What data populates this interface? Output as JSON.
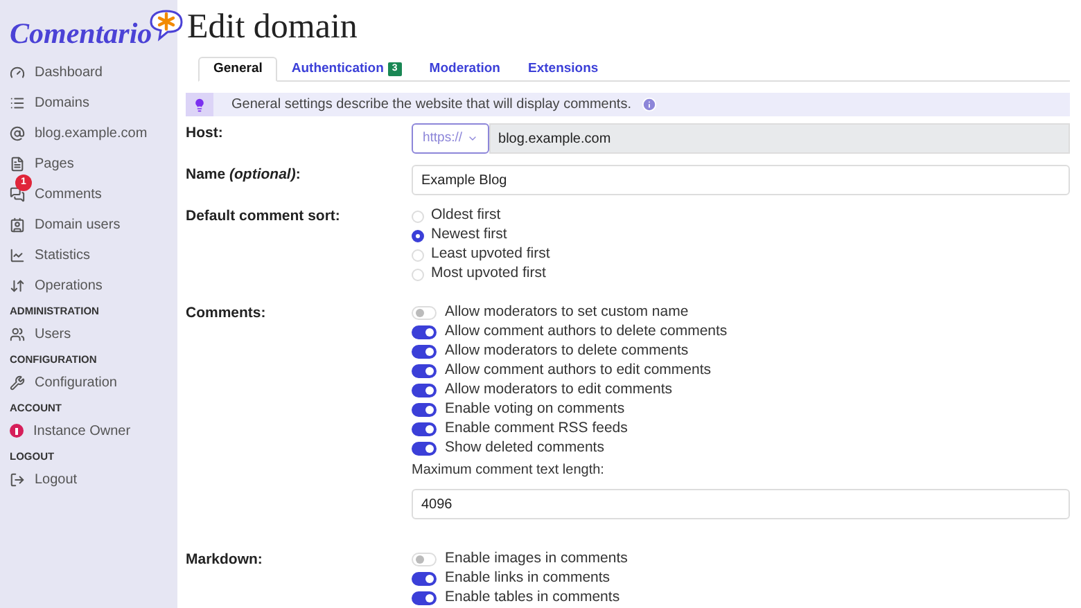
{
  "logo": "Comentario",
  "sidebar": {
    "items": [
      {
        "kind": "item",
        "label": "Dashboard"
      },
      {
        "kind": "item",
        "label": "Domains"
      },
      {
        "kind": "item",
        "label": "blog.example.com"
      },
      {
        "kind": "item",
        "label": "Pages"
      },
      {
        "kind": "item",
        "label": "Comments",
        "badge": "1"
      },
      {
        "kind": "item",
        "label": "Domain users"
      },
      {
        "kind": "item",
        "label": "Statistics"
      },
      {
        "kind": "item",
        "label": "Operations"
      },
      {
        "kind": "header",
        "label": "ADMINISTRATION"
      },
      {
        "kind": "item",
        "label": "Users"
      },
      {
        "kind": "header",
        "label": "CONFIGURATION"
      },
      {
        "kind": "item",
        "label": "Configuration"
      },
      {
        "kind": "header",
        "label": "ACCOUNT"
      },
      {
        "kind": "item",
        "label": "Instance Owner"
      },
      {
        "kind": "header",
        "label": "LOGOUT"
      },
      {
        "kind": "item",
        "label": "Logout"
      }
    ]
  },
  "title": "Edit domain",
  "tabs": [
    {
      "label": "General",
      "selected": true
    },
    {
      "label": "Authentication",
      "badge": "3",
      "selected": false
    },
    {
      "label": "Moderation",
      "selected": false
    },
    {
      "label": "Extensions",
      "selected": false
    }
  ],
  "info": "General settings describe the website that will display comments.",
  "host": {
    "label": "Host:",
    "scheme": "https://",
    "value": "blog.example.com"
  },
  "name": {
    "label": "Name *(optional)*:",
    "value": "Example Blog"
  },
  "sort": {
    "label": "Default comment sort:",
    "options": [
      {
        "label": "Oldest first",
        "selected": false
      },
      {
        "label": "Newest first",
        "selected": true
      },
      {
        "label": "Least upvoted first",
        "selected": false
      },
      {
        "label": "Most upvoted first",
        "selected": false
      }
    ]
  },
  "comments": {
    "label": "Comments:",
    "toggles": [
      {
        "label": "Allow moderators to set custom name",
        "on": false
      },
      {
        "label": "Allow comment authors to delete comments",
        "on": true
      },
      {
        "label": "Allow moderators to delete comments",
        "on": true
      },
      {
        "label": "Allow comment authors to edit comments",
        "on": true
      },
      {
        "label": "Allow moderators to edit comments",
        "on": true
      },
      {
        "label": "Enable voting on comments",
        "on": true
      },
      {
        "label": "Enable comment RSS feeds",
        "on": true
      },
      {
        "label": "Show deleted comments",
        "on": true
      }
    ],
    "max_length": {
      "label": "Maximum comment text length:",
      "value": "4096"
    }
  },
  "markdown": {
    "label": "Markdown:",
    "toggles": [
      {
        "label": "Enable images in comments",
        "on": false
      },
      {
        "label": "Enable links in comments",
        "on": true
      },
      {
        "label": "Enable tables in comments",
        "on": true
      }
    ]
  }
}
